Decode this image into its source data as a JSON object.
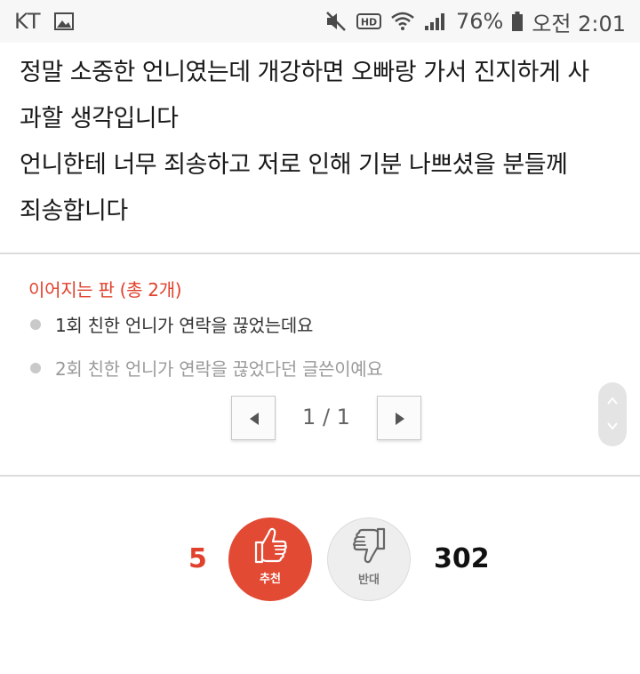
{
  "status_bar": {
    "carrier": "KT",
    "battery": "76%",
    "time": "오전 2:01",
    "icons": [
      "gallery-icon",
      "mute-icon",
      "hd-icon",
      "wifi-icon",
      "signal-icon",
      "battery-icon"
    ]
  },
  "article": {
    "lines": [
      "정말 소중한 언니였는데 개강하면 오빠랑 가서 진지하게 사",
      "과할 생각입니다",
      "언니한테 너무 죄송하고 저로 인해 기분 나쁘셨을 분들께",
      "죄송합니다"
    ]
  },
  "series": {
    "title": "이어지는 판 (총 2개)",
    "items": [
      {
        "label": "1회 친한 언니가 연락을 끊었는데요"
      },
      {
        "label": "2회 친한 언니가 연락을 끊었다던 글쓴이예요"
      }
    ]
  },
  "pagination": {
    "text": "1 / 1"
  },
  "votes": {
    "up_count": "5",
    "up_label": "추천",
    "down_count": "302",
    "down_label": "반대"
  },
  "colors": {
    "accent": "#e0412c",
    "current_item": "#333333",
    "other_item": "#9a9a9a"
  }
}
